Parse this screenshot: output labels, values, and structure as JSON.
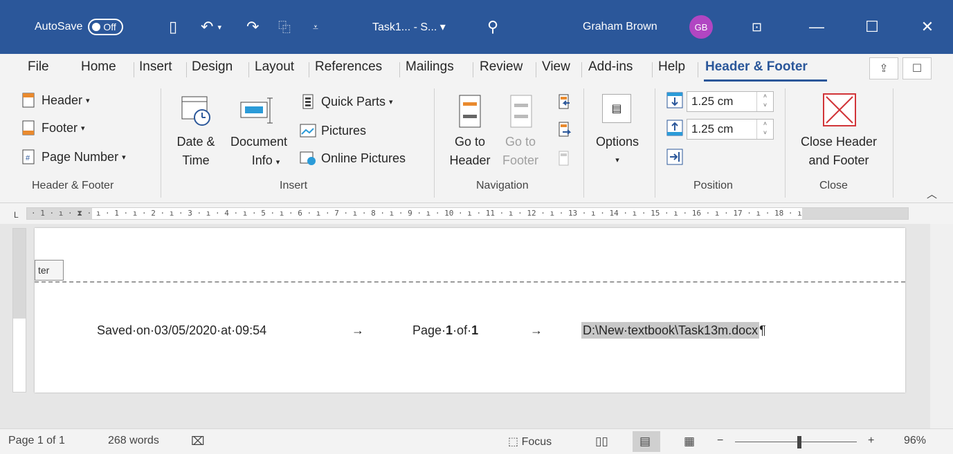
{
  "titlebar": {
    "autosave_label": "AutoSave",
    "autosave_state": "Off",
    "doc_title": "Task1... - S... ▾",
    "user_name": "Graham Brown",
    "user_initials": "GB",
    "bg_color": "#2b579a"
  },
  "tabs": [
    {
      "label": "File"
    },
    {
      "label": "Home"
    },
    {
      "label": "Insert"
    },
    {
      "label": "Design"
    },
    {
      "label": "Layout"
    },
    {
      "label": "References"
    },
    {
      "label": "Mailings"
    },
    {
      "label": "Review"
    },
    {
      "label": "View"
    },
    {
      "label": "Add-ins"
    },
    {
      "label": "Help"
    },
    {
      "label": "Header & Footer",
      "active": true
    }
  ],
  "ribbon": {
    "header_footer_group": {
      "header": "Header",
      "footer": "Footer",
      "page_number": "Page Number",
      "label": "Header & Footer"
    },
    "insert_group": {
      "date_time_1": "Date &",
      "date_time_2": "Time",
      "doc_info_1": "Document",
      "doc_info_2": "Info",
      "quick_parts": "Quick Parts",
      "pictures": "Pictures",
      "online_pictures": "Online Pictures",
      "label": "Insert"
    },
    "navigation_group": {
      "goto_header_1": "Go to",
      "goto_header_2": "Header",
      "goto_footer_1": "Go to",
      "goto_footer_2": "Footer",
      "label": "Navigation"
    },
    "options_group": {
      "options": "Options"
    },
    "position_group": {
      "header_from_top": "1.25 cm",
      "footer_from_bottom": "1.25 cm",
      "label": "Position"
    },
    "close_group": {
      "close_1": "Close Header",
      "close_2": "and Footer",
      "label": "Close"
    }
  },
  "ruler": {
    "text": "· 1 · ı · ⧗ · ı · 1 · ı · 2 · ı · 3 · ı · 4 · ı · 5 · ı · 6 · ı · 7 · ı · 8 · ı · 9 · ı · 10 · ı · 11 · ı · 12 · ı · 13 · ı · 14 · ı · 15 · ı · 16 · ı · 17 · ı · 18 · ı",
    "corner": "L"
  },
  "document": {
    "footer_tag": "ter",
    "saved_text": "Saved·on·03/05/2020·at·09:54",
    "arrow_1": "→",
    "page_prefix": "Page·",
    "page_num": "1",
    "page_of": "·of·",
    "page_total": "1",
    "arrow_2": "→",
    "path_text": "D:\\New·textbook\\Task13m.docx",
    "pilcrow": "¶"
  },
  "statusbar": {
    "page": "Page 1 of 1",
    "words": "268 words",
    "focus": "Focus",
    "zoom": "96%",
    "zoom_level_percent": 96
  }
}
